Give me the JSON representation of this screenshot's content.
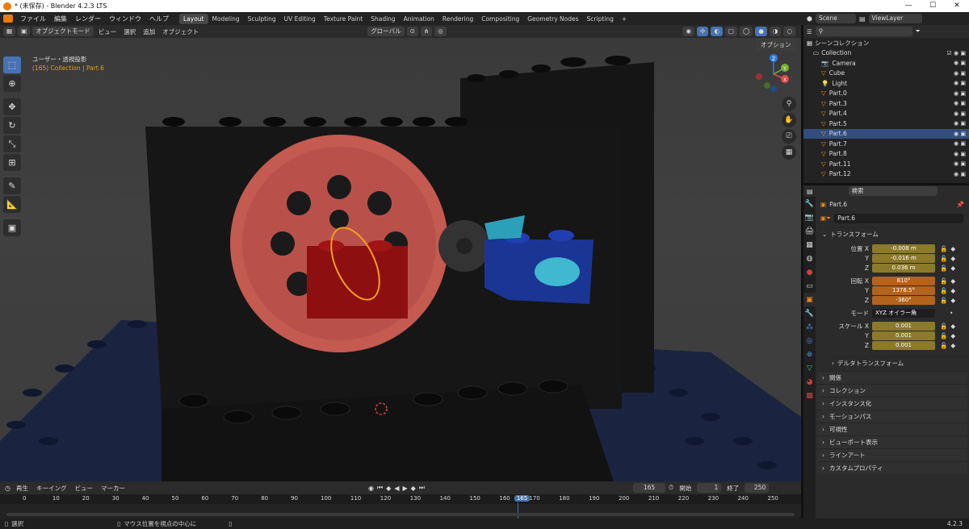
{
  "window": {
    "title": "* (未保存) - Blender 4.2.3 LTS",
    "controls": [
      "—",
      "☐",
      "✕"
    ]
  },
  "menus": [
    "ファイル",
    "編集",
    "レンダー",
    "ウィンドウ",
    "ヘルプ"
  ],
  "workspaces": [
    "Layout",
    "Modeling",
    "Sculpting",
    "UV Editing",
    "Texture Paint",
    "Shading",
    "Animation",
    "Rendering",
    "Compositing",
    "Geometry Nodes",
    "Scripting",
    "+"
  ],
  "active_workspace": "Layout",
  "scene": {
    "label": "Scene",
    "view_layer": "ViewLayer"
  },
  "viewport_header": {
    "mode": "オブジェクトモード",
    "menus": [
      "ビュー",
      "選択",
      "追加",
      "オブジェクト"
    ],
    "transform_orientation": "グローバル",
    "options": "オプション"
  },
  "viewport_info": {
    "line1": "ユーザー・透視投影",
    "line2": "(165) Collection | Part.6"
  },
  "gizmo_axes": [
    "X",
    "Y",
    "Z"
  ],
  "outliner": {
    "search_placeholder": "",
    "root": "シーンコレクション",
    "collection": "Collection",
    "items": [
      "Camera",
      "Cube",
      "Light",
      "Part.0",
      "Part.3",
      "Part.4",
      "Part.5",
      "Part.6",
      "Part.7",
      "Part.8",
      "Part.11",
      "Part.12"
    ],
    "selected": "Part.6"
  },
  "properties": {
    "search_placeholder": "検索",
    "object_name": "Part.6",
    "datablock": "Part.6",
    "transform_title": "トランスフォーム",
    "location_label": "位置",
    "rotation_label": "回転",
    "scale_label": "スケール",
    "mode_label": "モード",
    "mode_value": "XYZ オイラー角",
    "location": [
      "-0.008 m",
      "-0.016 m",
      "0.036 m"
    ],
    "rotation": [
      "810°",
      "1378.5°",
      "-360°"
    ],
    "scale": [
      "0.001",
      "0.001",
      "0.001"
    ],
    "axes": [
      "X",
      "Y",
      "Z"
    ],
    "delta_transform": "デルタトランスフォーム",
    "panels": [
      "関係",
      "コレクション",
      "インスタンス化",
      "モーションパス",
      "可視性",
      "ビューポート表示",
      "ラインアート",
      "カスタムプロパティ"
    ]
  },
  "timeline": {
    "menus": [
      "再生",
      "キーイング",
      "ビュー",
      "マーカー"
    ],
    "current_frame": "165",
    "start_label": "開始",
    "start": "1",
    "end_label": "終了",
    "end": "250",
    "ticks": [
      "0",
      "10",
      "20",
      "30",
      "40",
      "50",
      "60",
      "70",
      "80",
      "90",
      "100",
      "110",
      "120",
      "130",
      "140",
      "150",
      "160",
      "165",
      "170",
      "180",
      "190",
      "200",
      "210",
      "220",
      "230",
      "240",
      "250"
    ]
  },
  "statusbar": {
    "left": "選択",
    "middle": "マウス位置を視点の中心に",
    "version": "4.2.3"
  }
}
